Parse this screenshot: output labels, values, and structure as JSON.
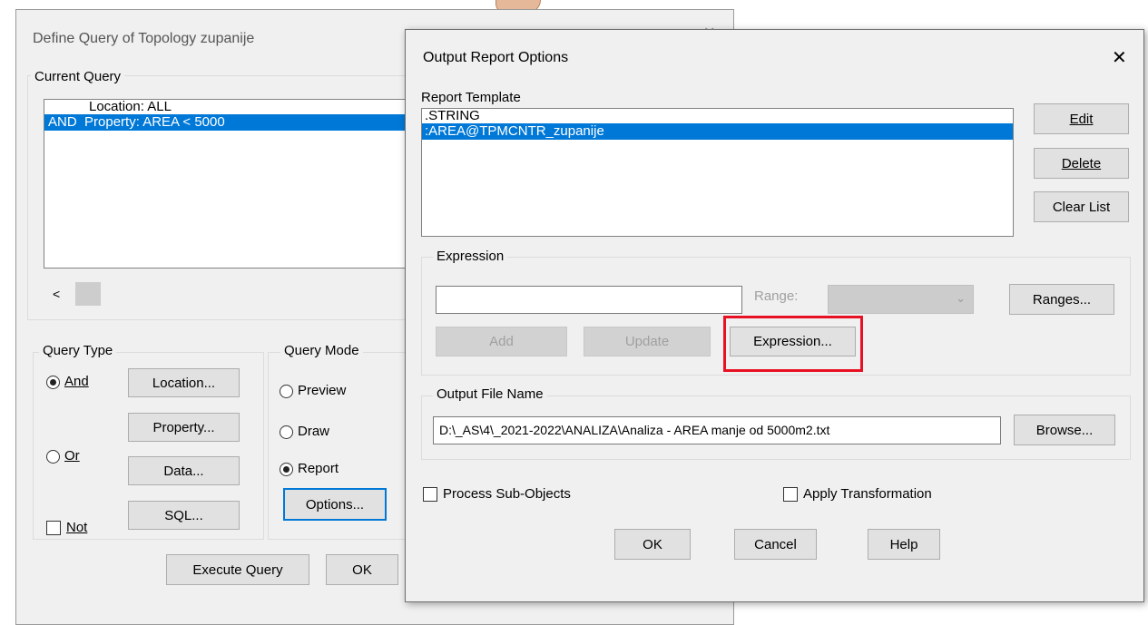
{
  "bg_dialog": {
    "title": "Define Query of Topology zupanije",
    "current_query": {
      "label": "Current Query",
      "rows": [
        "Location: ALL",
        "AND  Property: AREA < 5000"
      ],
      "scroll_left": "<"
    },
    "query_type": {
      "label": "Query Type",
      "and_label": "And",
      "or_label": "Or",
      "not_label": "Not",
      "location_btn": "Location...",
      "property_btn": "Property...",
      "data_btn": "Data...",
      "sql_btn": "SQL..."
    },
    "query_mode": {
      "label": "Query Mode",
      "preview_label": "Preview",
      "draw_label": "Draw",
      "report_label": "Report",
      "options_btn": "Options..."
    },
    "execute_btn": "Execute Query",
    "ok_btn": "OK",
    "close_glyph": "✕"
  },
  "dialog": {
    "title": "Output Report Options",
    "close_glyph": "✕",
    "report_template": {
      "label": "Report Template",
      "items": [
        ".STRING",
        ":AREA@TPMCNTR_zupanije"
      ],
      "edit_btn": "Edit",
      "delete_btn": "Delete",
      "clear_btn": "Clear List"
    },
    "expression": {
      "label": "Expression",
      "input_value": "",
      "range_label": "Range:",
      "range_value": "",
      "ranges_btn": "Ranges...",
      "add_btn": "Add",
      "update_btn": "Update",
      "expression_btn": "Expression..."
    },
    "output_file": {
      "label": "Output File Name",
      "path": "D:\\_AS\\4\\_2021-2022\\ANALIZA\\Analiza - AREA manje od 5000m2.txt",
      "browse_btn": "Browse..."
    },
    "process_sub_objects": "Process Sub-Objects",
    "apply_transformation": "Apply Transformation",
    "ok_btn": "OK",
    "cancel_btn": "Cancel",
    "help_btn": "Help"
  },
  "colors": {
    "selection": "#0078d7",
    "highlight": "#e81123",
    "dialog_bg": "#f0f0f0"
  }
}
